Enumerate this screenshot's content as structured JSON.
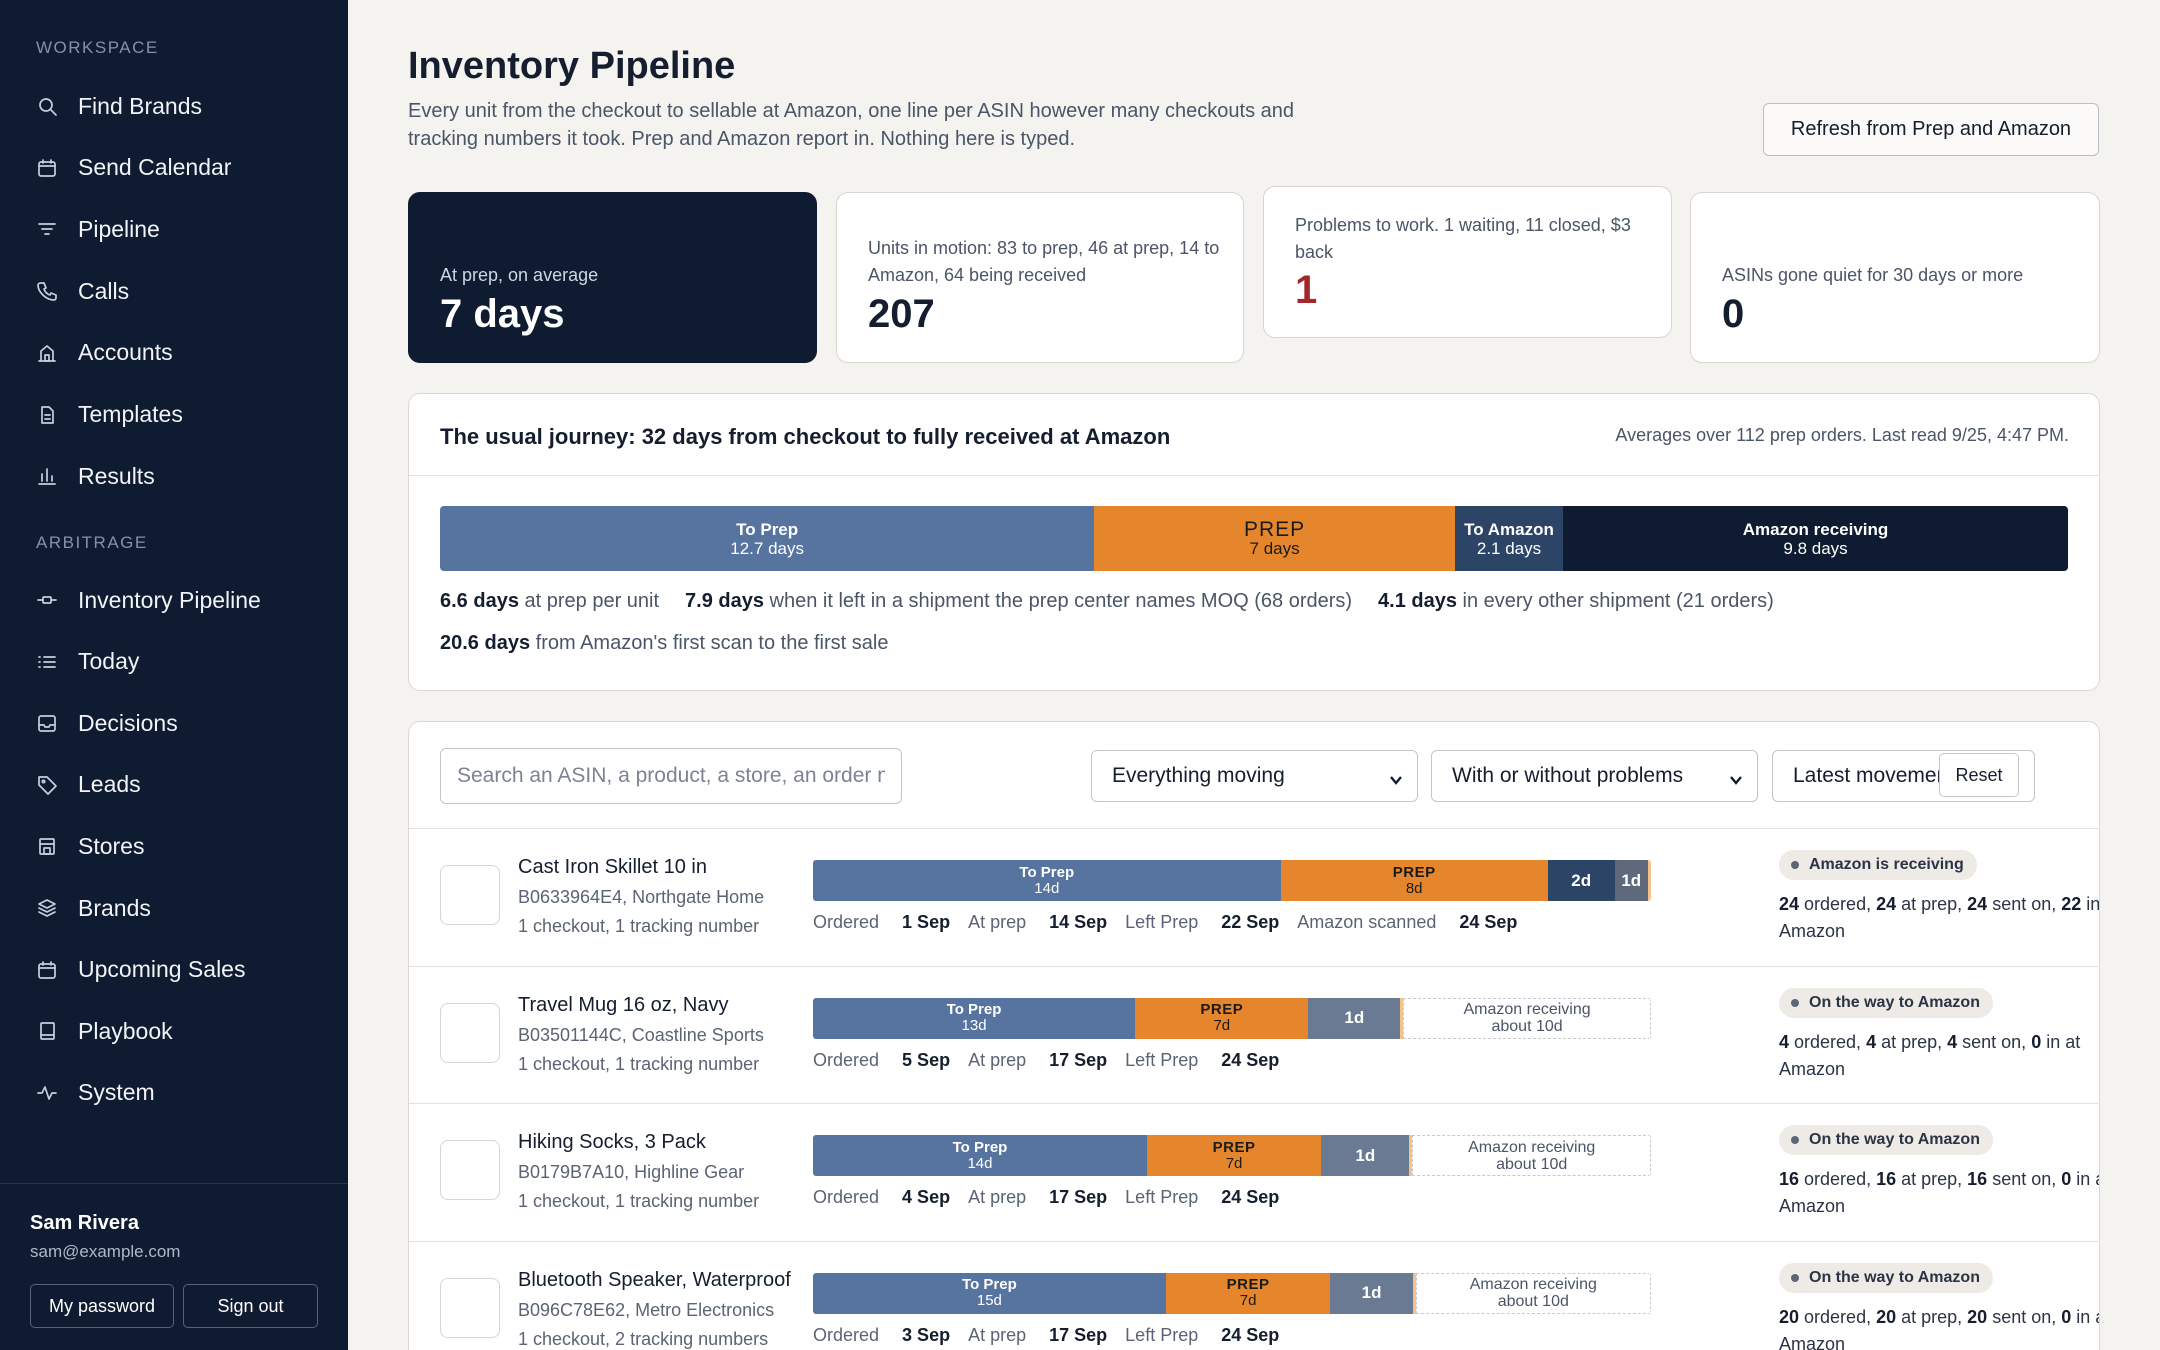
{
  "sidebar": {
    "workspace_label": "WORKSPACE",
    "workspace_items": [
      {
        "label": "Find Brands",
        "icon": "search-icon"
      },
      {
        "label": "Send Calendar",
        "icon": "calendar-icon"
      },
      {
        "label": "Pipeline",
        "icon": "filter-icon"
      },
      {
        "label": "Calls",
        "icon": "phone-icon"
      },
      {
        "label": "Accounts",
        "icon": "building-icon"
      },
      {
        "label": "Templates",
        "icon": "document-icon"
      },
      {
        "label": "Results",
        "icon": "bar-chart-icon"
      }
    ],
    "arbitrage_label": "ARBITRAGE",
    "arbitrage_items": [
      {
        "label": "Inventory Pipeline",
        "icon": "pipeline-icon"
      },
      {
        "label": "Today",
        "icon": "list-icon"
      },
      {
        "label": "Decisions",
        "icon": "inbox-icon"
      },
      {
        "label": "Leads",
        "icon": "tag-icon"
      },
      {
        "label": "Stores",
        "icon": "store-icon"
      },
      {
        "label": "Brands",
        "icon": "layers-icon"
      },
      {
        "label": "Upcoming Sales",
        "icon": "calendar-icon"
      },
      {
        "label": "Playbook",
        "icon": "book-icon"
      },
      {
        "label": "System",
        "icon": "activity-icon"
      }
    ],
    "user": {
      "name": "Sam Rivera",
      "email": "sam@example.com"
    },
    "password_label": "My password",
    "signout_label": "Sign out"
  },
  "header": {
    "title": "Inventory Pipeline",
    "subtitle": "Every unit from the checkout to sellable at Amazon, one line per ASIN however many checkouts and tracking numbers it took. Prep and Amazon report in. Nothing here is typed.",
    "refresh_label": "Refresh from Prep and Amazon"
  },
  "stats": [
    {
      "caption": "At prep, on average",
      "value": "7 days"
    },
    {
      "caption": "Units in motion: 83 to prep, 46 at prep, 14 to Amazon, 64 being received",
      "value": "207"
    },
    {
      "caption": "Problems to work. 1 waiting, 11 closed, $3 back",
      "value": "1"
    },
    {
      "caption": "ASINs gone quiet for 30 days or more",
      "value": "0"
    }
  ],
  "journey": {
    "title": "The usual journey: 32 days from checkout to fully received at Amazon",
    "note": "Averages over 112 prep orders. Last read 9/25, 4:47 PM.",
    "segments": [
      {
        "label": "To Prep",
        "detail": "12.7 days",
        "days": 12.7,
        "color": "#5774a0"
      },
      {
        "label": "PREP",
        "detail": "7 days",
        "days": 7,
        "color": "#e5862c"
      },
      {
        "label": "To Amazon",
        "detail": "2.1 days",
        "days": 2.1,
        "color": "#2c4466"
      },
      {
        "label": "Amazon receiving",
        "detail": "9.8 days",
        "days": 9.8,
        "color": "#0e1b30"
      }
    ],
    "facts": [
      {
        "num": "6.6 days",
        "text": " at prep per unit"
      },
      {
        "num": "7.9 days",
        "text": " when it left in a shipment the prep center names MOQ (68 orders)"
      },
      {
        "num": "4.1 days",
        "text": " in every other shipment (21 orders)"
      }
    ],
    "facts2": {
      "num": "20.6 days",
      "text": " from Amazon's first scan to the first sale"
    }
  },
  "filters": {
    "search_placeholder": "Search an ASIN, a product, a store, an order number or a tracking number",
    "status": "Everything moving",
    "problems": "With or without problems",
    "sort": "Latest movement first",
    "reset_label": "Reset"
  },
  "rows": [
    {
      "name": "Cast Iron Skillet 10 in",
      "meta": "B0633964E4, Northgate Home",
      "meta2": "1 checkout, 1 tracking number",
      "segments": [
        {
          "kind": "toprep",
          "label": "To Prep",
          "detail": "14d",
          "days": 14
        },
        {
          "kind": "prep",
          "label": "PREP",
          "detail": "8d",
          "days": 8
        },
        {
          "kind": "toamz",
          "label": "2d",
          "days": 2
        },
        {
          "kind": "recv",
          "label": "1d",
          "days": 1
        }
      ],
      "dates": [
        {
          "label": "Ordered ",
          "value": "1 Sep"
        },
        {
          "label": "At prep ",
          "value": "14 Sep"
        },
        {
          "label": "Left Prep ",
          "value": "22 Sep"
        },
        {
          "label": "Amazon scanned ",
          "value": "24 Sep"
        }
      ],
      "badge": "Amazon is receiving",
      "summary": [
        {
          "n": "24",
          "t": " ordered, "
        },
        {
          "n": "24",
          "t": " at prep, "
        },
        {
          "n": "24",
          "t": " sent on, "
        },
        {
          "n": "22",
          "t": " in at Amazon"
        }
      ]
    },
    {
      "name": "Travel Mug 16 oz, Navy",
      "meta": "B03501144C, Coastline Sports",
      "meta2": "1 checkout, 1 tracking number",
      "segments": [
        {
          "kind": "toprep",
          "label": "To Prep",
          "detail": "13d",
          "days": 13
        },
        {
          "kind": "prep",
          "label": "PREP",
          "detail": "7d",
          "days": 7
        },
        {
          "kind": "toamz2",
          "label": "1d",
          "days": 3.7
        },
        {
          "kind": "est",
          "label": "Amazon receiving",
          "detail": "about 10d",
          "days": 10
        }
      ],
      "dates": [
        {
          "label": "Ordered ",
          "value": "5 Sep"
        },
        {
          "label": "At prep ",
          "value": "17 Sep"
        },
        {
          "label": "Left Prep ",
          "value": "24 Sep"
        }
      ],
      "badge": "On the way to Amazon",
      "summary": [
        {
          "n": "4",
          "t": " ordered, "
        },
        {
          "n": "4",
          "t": " at prep, "
        },
        {
          "n": "4",
          "t": " sent on, "
        },
        {
          "n": "0",
          "t": " in at Amazon"
        }
      ]
    },
    {
      "name": "Hiking Socks, 3 Pack",
      "meta": "B0179B7A10, Highline Gear",
      "meta2": "1 checkout, 1 tracking number",
      "segments": [
        {
          "kind": "toprep",
          "label": "To Prep",
          "detail": "14d",
          "days": 14
        },
        {
          "kind": "prep",
          "label": "PREP",
          "detail": "7d",
          "days": 7.3
        },
        {
          "kind": "toamz2",
          "label": "1d",
          "days": 3.7
        },
        {
          "kind": "est",
          "label": "Amazon receiving",
          "detail": "about 10d",
          "days": 10
        }
      ],
      "dates": [
        {
          "label": "Ordered ",
          "value": "4 Sep"
        },
        {
          "label": "At prep ",
          "value": "17 Sep"
        },
        {
          "label": "Left Prep ",
          "value": "24 Sep"
        }
      ],
      "badge": "On the way to Amazon",
      "summary": [
        {
          "n": "16",
          "t": " ordered, "
        },
        {
          "n": "16",
          "t": " at prep, "
        },
        {
          "n": "16",
          "t": " sent on, "
        },
        {
          "n": "0",
          "t": " in at Amazon"
        }
      ]
    },
    {
      "name": "Bluetooth Speaker, Waterproof",
      "meta": "B096C78E62, Metro Electronics",
      "meta2": "1 checkout, 2 tracking numbers",
      "segments": [
        {
          "kind": "toprep",
          "label": "To Prep",
          "detail": "15d",
          "days": 15
        },
        {
          "kind": "prep",
          "label": "PREP",
          "detail": "7d",
          "days": 7
        },
        {
          "kind": "toamz2",
          "label": "1d",
          "days": 3.5
        },
        {
          "kind": "est",
          "label": "Amazon receiving",
          "detail": "about 10d",
          "days": 10
        }
      ],
      "dates": [
        {
          "label": "Ordered ",
          "value": "3 Sep"
        },
        {
          "label": "At prep ",
          "value": "17 Sep"
        },
        {
          "label": "Left Prep ",
          "value": "24 Sep"
        }
      ],
      "badge": "On the way to Amazon",
      "summary": [
        {
          "n": "20",
          "t": " ordered, "
        },
        {
          "n": "20",
          "t": " at prep, "
        },
        {
          "n": "20",
          "t": " sent on, "
        },
        {
          "n": "0",
          "t": " in at Amazon"
        }
      ]
    }
  ],
  "colors": {
    "sidebar": "#0e1b30",
    "to_prep": "#5774a0",
    "prep": "#e5862c",
    "to_amazon": "#2c4466",
    "to_amazon_light": "#6a7a92",
    "receiving_dark": "#0e1b30",
    "receiving_gray": "#5e6a7c",
    "problem_red": "#a3262a"
  }
}
